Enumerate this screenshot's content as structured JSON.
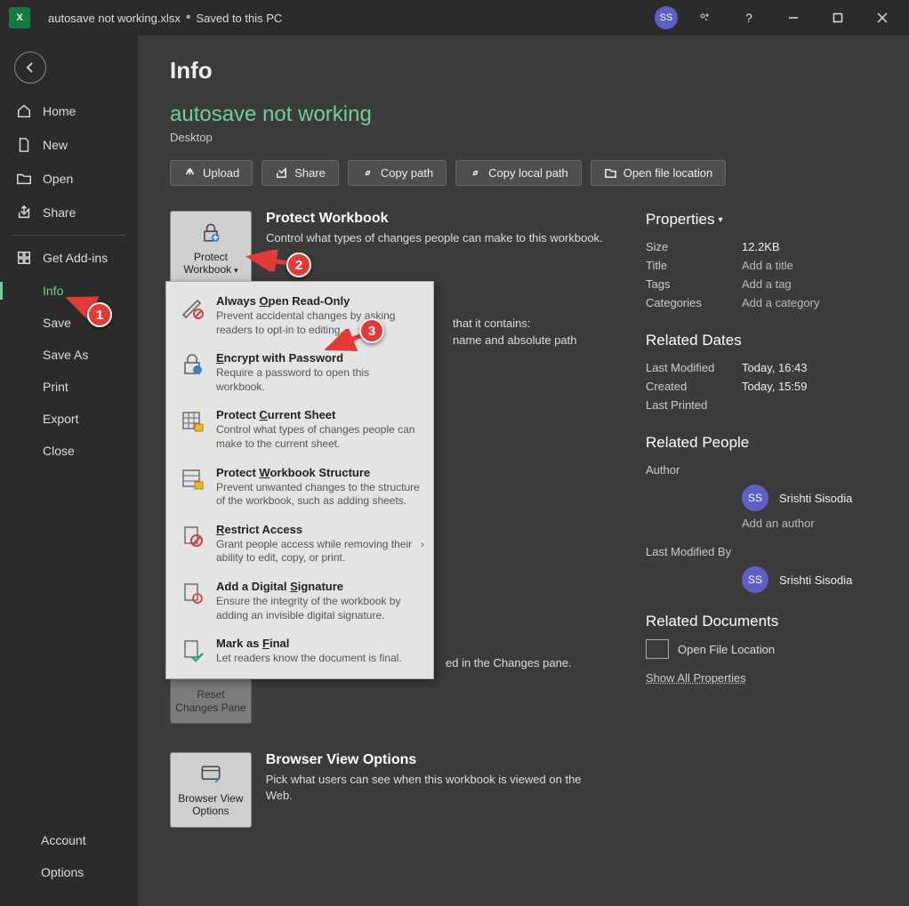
{
  "titlebar": {
    "filename": "autosave not working.xlsx",
    "save_state": "Saved to this PC",
    "user_initials": "SS"
  },
  "sidebar": {
    "home": "Home",
    "new": "New",
    "open": "Open",
    "share": "Share",
    "addins": "Get Add-ins",
    "info": "Info",
    "save": "Save",
    "saveas": "Save As",
    "print": "Print",
    "export": "Export",
    "close": "Close",
    "account": "Account",
    "options": "Options"
  },
  "content": {
    "heading": "Info",
    "doc_title": "autosave not working",
    "doc_location": "Desktop",
    "actions": {
      "upload": "Upload",
      "share": "Share",
      "copypath": "Copy path",
      "copylocal": "Copy local path",
      "openloc": "Open file location"
    },
    "protect": {
      "btn": "Protect Workbook",
      "title": "Protect Workbook",
      "desc": "Control what types of changes people can make to this workbook."
    },
    "inspect_visible": {
      "l1": "that it contains:",
      "l2": "name and absolute path"
    },
    "changes_visible": "ed in the Changes pane.",
    "reset_changes": "Reset Changes Pane",
    "browser": {
      "btn": "Browser View Options",
      "title": "Browser View Options",
      "desc": "Pick what users can see when this workbook is viewed on the Web."
    }
  },
  "dropdown": {
    "readonly": {
      "title_pre": "Always ",
      "title_u": "O",
      "title_post": "pen Read-Only",
      "desc": "Prevent accidental changes by asking readers to opt-in to editing."
    },
    "encrypt": {
      "title_u": "E",
      "title_post": "ncrypt with Password",
      "desc": "Require a password to open this workbook."
    },
    "sheet": {
      "title_pre": "Protect ",
      "title_u": "C",
      "title_post": "urrent Sheet",
      "desc": "Control what types of changes people can make to the current sheet."
    },
    "structure": {
      "title_pre": "Protect ",
      "title_u": "W",
      "title_post": "orkbook Structure",
      "desc": "Prevent unwanted changes to the structure of the workbook, such as adding sheets."
    },
    "restrict": {
      "title_u": "R",
      "title_post": "estrict Access",
      "desc": "Grant people access while removing their ability to edit, copy, or print."
    },
    "signature": {
      "title_pre": "Add a Digital ",
      "title_u": "S",
      "title_post": "ignature",
      "desc": "Ensure the integrity of the workbook by adding an invisible digital signature."
    },
    "final": {
      "title_pre": "Mark as ",
      "title_u": "F",
      "title_post": "inal",
      "desc": "Let readers know the document is final."
    }
  },
  "properties": {
    "heading": "Properties",
    "size_l": "Size",
    "size_v": "12.2KB",
    "title_l": "Title",
    "title_v": "Add a title",
    "tags_l": "Tags",
    "tags_v": "Add a tag",
    "cat_l": "Categories",
    "cat_v": "Add a category",
    "dates_h": "Related Dates",
    "lastmod_l": "Last Modified",
    "lastmod_v": "Today, 16:43",
    "created_l": "Created",
    "created_v": "Today, 15:59",
    "printed_l": "Last Printed",
    "people_h": "Related People",
    "author_l": "Author",
    "author_name": "Srishti Sisodia",
    "author_initials": "SS",
    "add_author": "Add an author",
    "modby_l": "Last Modified By",
    "modby_name": "Srishti Sisodia",
    "modby_initials": "SS",
    "docs_h": "Related Documents",
    "openloc": "Open File Location",
    "showall": "Show All Properties"
  },
  "annotations": {
    "n1": "1",
    "n2": "2",
    "n3": "3"
  }
}
